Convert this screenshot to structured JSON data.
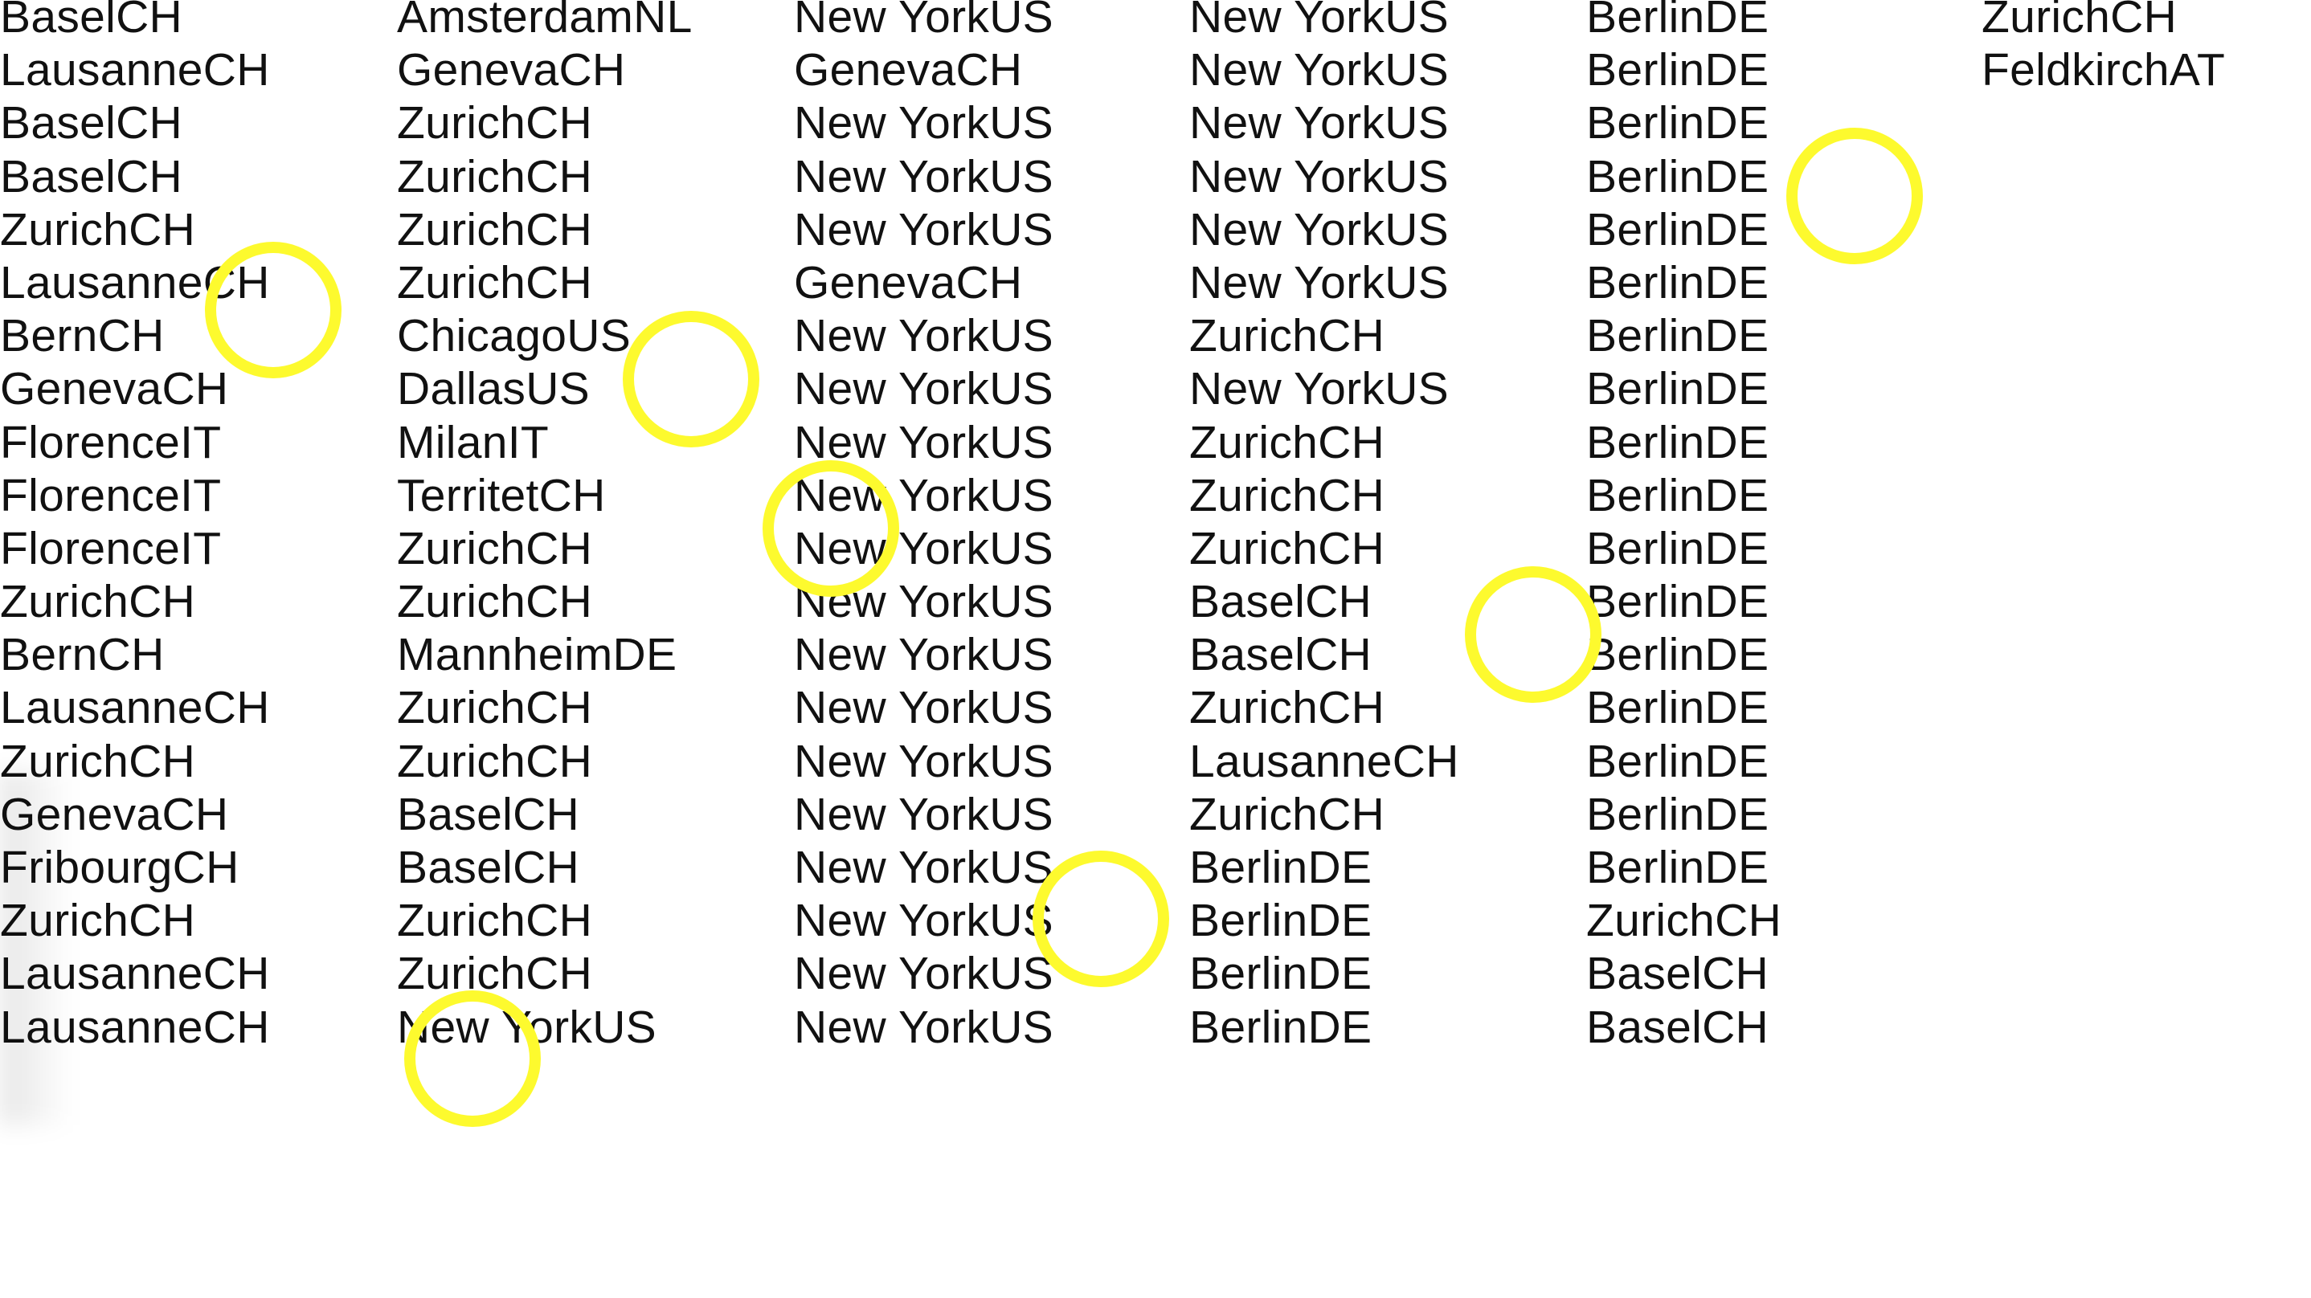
{
  "columns": [
    {
      "cells": [
        "BaselCH",
        "LausanneCH",
        "BaselCH",
        "BaselCH",
        "ZurichCH",
        "LausanneCH",
        "BernCH",
        "GenevaCH",
        "FlorenceIT",
        "FlorenceIT",
        "FlorenceIT",
        "ZurichCH",
        "BernCH",
        "LausanneCH",
        "ZurichCH",
        "GenevaCH",
        "FribourgCH",
        "ZurichCH",
        "LausanneCH",
        "LausanneCH"
      ]
    },
    {
      "cells": [
        "AmsterdamNL",
        "GenevaCH",
        "ZurichCH",
        "ZurichCH",
        "ZurichCH",
        "ZurichCH",
        "ChicagoUS",
        "DallasUS",
        "MilanIT",
        "TerritetCH",
        "ZurichCH",
        "ZurichCH",
        "MannheimDE",
        "ZurichCH",
        "ZurichCH",
        "BaselCH",
        "BaselCH",
        "ZurichCH",
        "ZurichCH",
        "New YorkUS"
      ]
    },
    {
      "cells": [
        "New YorkUS",
        "GenevaCH",
        "New YorkUS",
        "New YorkUS",
        "New YorkUS",
        "GenevaCH",
        "New YorkUS",
        "New YorkUS",
        "New YorkUS",
        "New YorkUS",
        "New YorkUS",
        "New YorkUS",
        "New YorkUS",
        "New YorkUS",
        "New YorkUS",
        "New YorkUS",
        "New YorkUS",
        "New YorkUS",
        "New YorkUS",
        "New YorkUS"
      ]
    },
    {
      "cells": [
        "New YorkUS",
        "New YorkUS",
        "New YorkUS",
        "New YorkUS",
        "New YorkUS",
        "New YorkUS",
        "ZurichCH",
        "New YorkUS",
        "ZurichCH",
        "ZurichCH",
        "ZurichCH",
        "BaselCH",
        "BaselCH",
        "ZurichCH",
        "LausanneCH",
        "ZurichCH",
        "BerlinDE",
        "BerlinDE",
        "BerlinDE",
        "BerlinDE"
      ]
    },
    {
      "cells": [
        "BerlinDE",
        "BerlinDE",
        "BerlinDE",
        "BerlinDE",
        "BerlinDE",
        "BerlinDE",
        "BerlinDE",
        "BerlinDE",
        "BerlinDE",
        "BerlinDE",
        "BerlinDE",
        "BerlinDE",
        "BerlinDE",
        "BerlinDE",
        "BerlinDE",
        "BerlinDE",
        "BerlinDE",
        "ZurichCH",
        "BaselCH",
        "BaselCH"
      ]
    },
    {
      "cells": [
        "ZurichCH",
        "FeldkirchAT"
      ]
    }
  ],
  "marker_color": "#fdfa2e",
  "marker_count": 8
}
